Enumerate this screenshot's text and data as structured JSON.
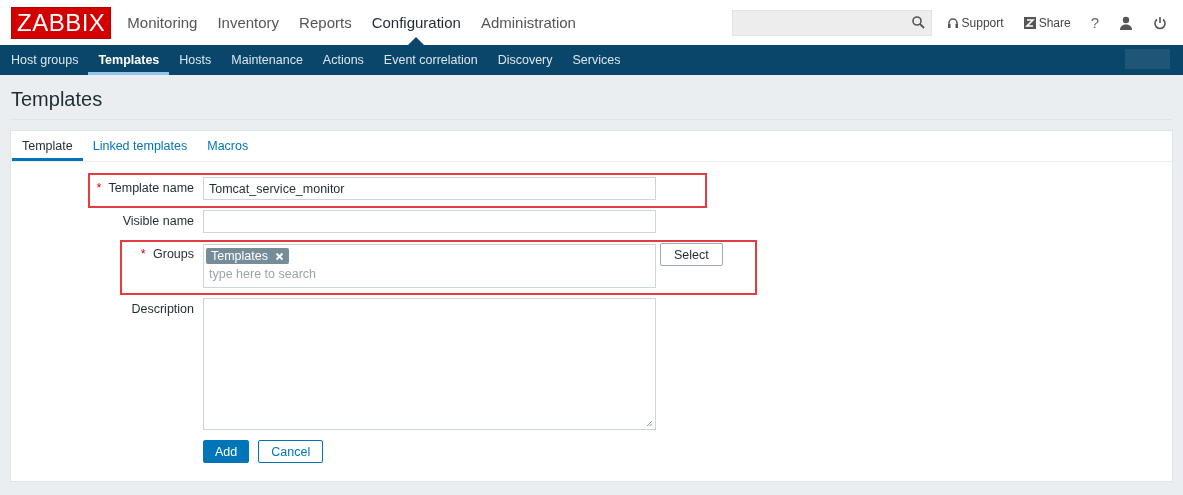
{
  "logo": "ZABBIX",
  "main_menu": [
    {
      "label": "Monitoring",
      "selected": false
    },
    {
      "label": "Inventory",
      "selected": false
    },
    {
      "label": "Reports",
      "selected": false
    },
    {
      "label": "Configuration",
      "selected": true
    },
    {
      "label": "Administration",
      "selected": false
    }
  ],
  "header_links": [
    {
      "kind": "support",
      "label": "Support"
    },
    {
      "kind": "share",
      "label": "Share"
    },
    {
      "kind": "help",
      "label": "?"
    },
    {
      "kind": "user"
    },
    {
      "kind": "logout"
    }
  ],
  "sub_menu": [
    {
      "label": "Host groups",
      "selected": false
    },
    {
      "label": "Templates",
      "selected": true
    },
    {
      "label": "Hosts",
      "selected": false
    },
    {
      "label": "Maintenance",
      "selected": false
    },
    {
      "label": "Actions",
      "selected": false
    },
    {
      "label": "Event correlation",
      "selected": false
    },
    {
      "label": "Discovery",
      "selected": false
    },
    {
      "label": "Services",
      "selected": false
    }
  ],
  "page_title": "Templates",
  "tabs": [
    {
      "label": "Template",
      "selected": true
    },
    {
      "label": "Linked templates",
      "selected": false
    },
    {
      "label": "Macros",
      "selected": false
    }
  ],
  "form": [
    {
      "kind": "text",
      "label": "Template name",
      "required_mark": "*",
      "value": "Tomcat_service_monitor",
      "highlighted": true
    },
    {
      "kind": "text",
      "label": "Visible name",
      "highlighted": false
    },
    {
      "kind": "multiselect",
      "label": "Groups",
      "required_mark": "*",
      "tags": [
        "Templates"
      ],
      "placeholder": "type here to search",
      "button": "Select",
      "highlighted": true
    },
    {
      "kind": "textarea",
      "label": "Description",
      "highlighted": false
    }
  ],
  "buttons": [
    {
      "label": "Add",
      "kind": "primary"
    },
    {
      "label": "Cancel",
      "kind": "secondary"
    }
  ]
}
